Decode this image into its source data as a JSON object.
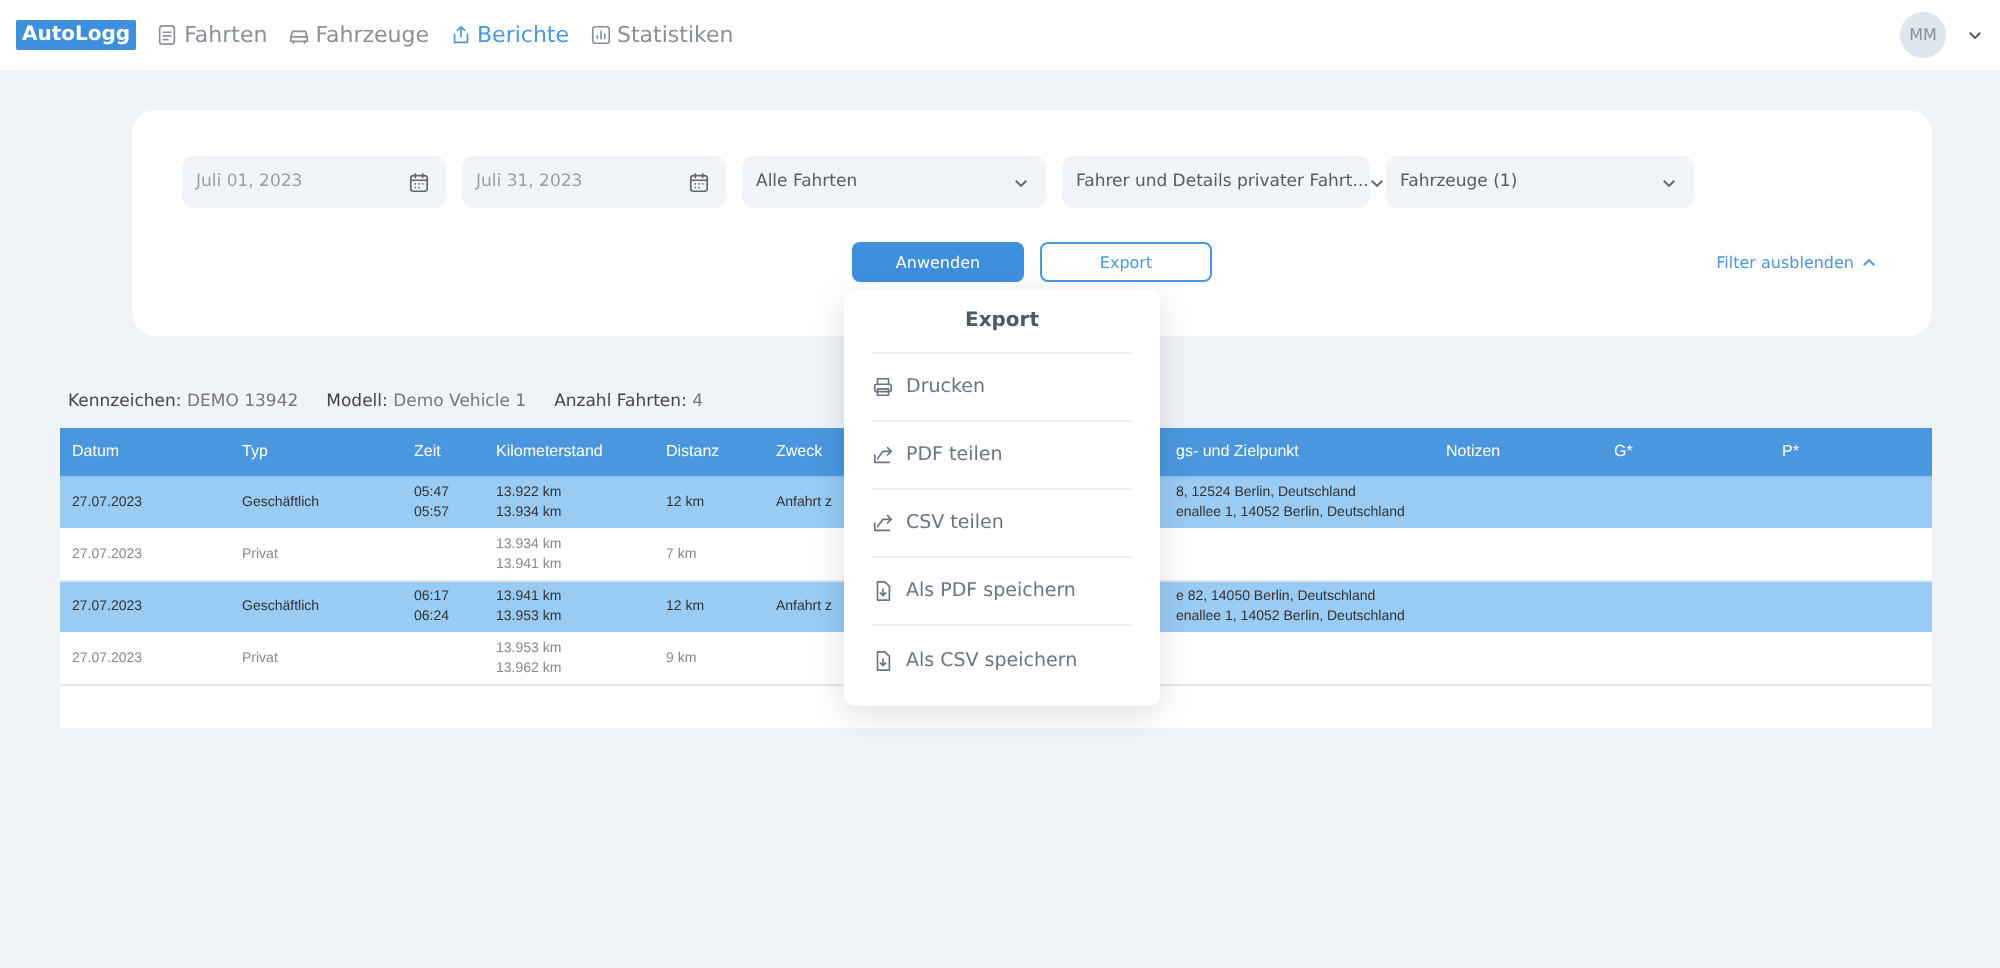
{
  "nav": {
    "logo": "AutoLogg",
    "items": [
      {
        "label": "Fahrten",
        "selected": false
      },
      {
        "label": "Fahrzeuge",
        "selected": false
      },
      {
        "label": "Berichte",
        "selected": true
      },
      {
        "label": "Statistiken",
        "selected": false
      }
    ],
    "avatar": "MM"
  },
  "filters": {
    "fields": [
      {
        "kind": "date",
        "value": "Juli 01, 2023"
      },
      {
        "kind": "date",
        "value": "Juli 31, 2023"
      },
      {
        "kind": "select",
        "value": "Alle Fahrten"
      },
      {
        "kind": "select",
        "value": "Fahrer und Details privater Fahrt..."
      },
      {
        "kind": "select",
        "value": "Fahrzeuge (1)"
      }
    ],
    "apply_button": "Anwenden",
    "export_button": "Export",
    "toggle": "Filter ausblenden"
  },
  "summary": [
    {
      "label": "Kennzeichen:",
      "value": "DEMO 13942"
    },
    {
      "label": "Modell:",
      "value": "Demo Vehicle 1"
    },
    {
      "label": "Anzahl Fahrten:",
      "value": "4"
    }
  ],
  "table": {
    "columns": [
      "Datum",
      "Typ",
      "Zeit",
      "Kilometerstand",
      "Distanz",
      "Zweck",
      "gs- und Zielpunkt",
      "Notizen",
      "G*",
      "P*"
    ],
    "rows": [
      {
        "selected": true,
        "cells": [
          "27.07.2023",
          "Geschäftlich",
          [
            "05:47",
            "05:57"
          ],
          [
            "13.922 km",
            "13.934 km"
          ],
          "12 km",
          "Anfahrt z",
          [
            "8, 12524 Berlin, Deutschland",
            "enallee 1, 14052 Berlin, Deutschland"
          ],
          "",
          "",
          ""
        ]
      },
      {
        "selected": false,
        "cells": [
          "27.07.2023",
          "Privat",
          "",
          [
            "13.934 km",
            "13.941 km"
          ],
          "7 km",
          "",
          "",
          "",
          "",
          ""
        ]
      },
      {
        "selected": true,
        "cells": [
          "27.07.2023",
          "Geschäftlich",
          [
            "06:17",
            "06:24"
          ],
          [
            "13.941 km",
            "13.953 km"
          ],
          "12 km",
          "Anfahrt z",
          [
            "e 82, 14050 Berlin, Deutschland",
            "enallee 1, 14052 Berlin, Deutschland"
          ],
          "",
          "",
          ""
        ]
      },
      {
        "selected": false,
        "cells": [
          "27.07.2023",
          "Privat",
          "",
          [
            "13.953 km",
            "13.962 km"
          ],
          "9 km",
          "",
          "",
          "",
          "",
          ""
        ]
      }
    ]
  },
  "export_menu": {
    "title": "Export",
    "items": [
      "Drucken",
      "PDF teilen",
      "CSV teilen",
      "Als PDF speichern",
      "Als CSV speichern"
    ]
  }
}
